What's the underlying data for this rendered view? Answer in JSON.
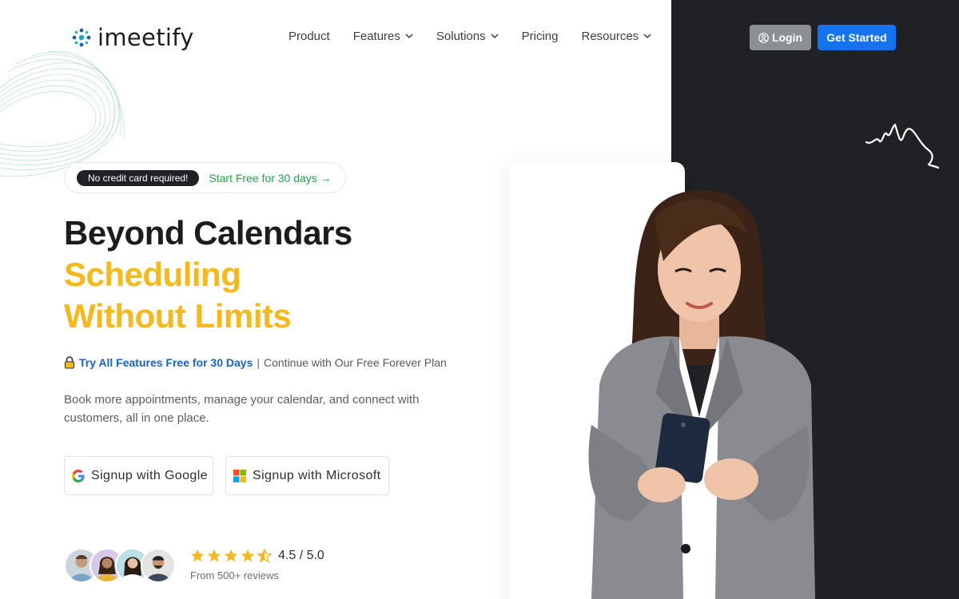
{
  "brand": {
    "name": "imeetify"
  },
  "nav": {
    "items": [
      {
        "label": "Product",
        "has_dropdown": false
      },
      {
        "label": "Features",
        "has_dropdown": true
      },
      {
        "label": "Solutions",
        "has_dropdown": true
      },
      {
        "label": "Pricing",
        "has_dropdown": false
      },
      {
        "label": "Resources",
        "has_dropdown": true
      }
    ],
    "login_label": "Login",
    "get_started_label": "Get Started"
  },
  "hero": {
    "badge": "No credit card required!",
    "badge_link": "Start Free for 30 days →",
    "headline_1": "Beyond Calendars",
    "headline_2": "Scheduling",
    "headline_3": "Without Limits",
    "trial_link": "Try All Features Free for 30 Days",
    "trial_sep": "|",
    "trial_rest": "Continue with Our Free Forever Plan",
    "description": "Book more appointments, manage your calendar, and connect with customers, all in one place.",
    "signup_google": "Signup with Google",
    "signup_microsoft": "Signup with Microsoft"
  },
  "reviews": {
    "rating_text": "4.5 / 5.0",
    "rating_value": 4.5,
    "count_text": "From 500+ reviews"
  },
  "colors": {
    "accent_blue": "#1473f0",
    "headline_yellow": "#f6b81a",
    "dark_panel": "#202125",
    "green_link": "#1fa64a",
    "star": "#f6b81a"
  },
  "icons": [
    "logo-dots-icon",
    "chevron-down-icon",
    "user-circle-icon",
    "lock-icon",
    "google-icon",
    "microsoft-icon",
    "star-icon",
    "half-star-icon"
  ]
}
